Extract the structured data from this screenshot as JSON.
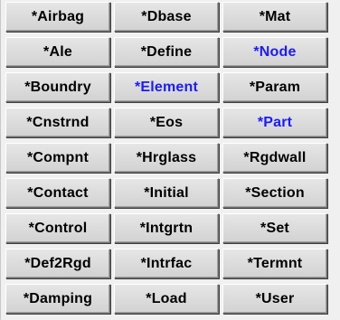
{
  "keyword_panel": {
    "colors": {
      "button_face": "#dcdcdc",
      "text": "#000000",
      "active_text": "#1a1aff"
    },
    "buttons": [
      {
        "label": "*Airbag",
        "active": false
      },
      {
        "label": "*Dbase",
        "active": false
      },
      {
        "label": "*Mat",
        "active": false
      },
      {
        "label": "*Ale",
        "active": false
      },
      {
        "label": "*Define",
        "active": false
      },
      {
        "label": "*Node",
        "active": true
      },
      {
        "label": "*Boundry",
        "active": false
      },
      {
        "label": "*Element",
        "active": true
      },
      {
        "label": "*Param",
        "active": false
      },
      {
        "label": "*Cnstrnd",
        "active": false
      },
      {
        "label": "*Eos",
        "active": false
      },
      {
        "label": "*Part",
        "active": true
      },
      {
        "label": "*Compnt",
        "active": false
      },
      {
        "label": "*Hrglass",
        "active": false
      },
      {
        "label": "*Rgdwall",
        "active": false
      },
      {
        "label": "*Contact",
        "active": false
      },
      {
        "label": "*Initial",
        "active": false
      },
      {
        "label": "*Section",
        "active": false
      },
      {
        "label": "*Control",
        "active": false
      },
      {
        "label": "*Intgrtn",
        "active": false
      },
      {
        "label": "*Set",
        "active": false
      },
      {
        "label": "*Def2Rgd",
        "active": false
      },
      {
        "label": "*Intrfac",
        "active": false
      },
      {
        "label": "*Termnt",
        "active": false
      },
      {
        "label": "*Damping",
        "active": false
      },
      {
        "label": "*Load",
        "active": false
      },
      {
        "label": "*User",
        "active": false
      }
    ]
  }
}
